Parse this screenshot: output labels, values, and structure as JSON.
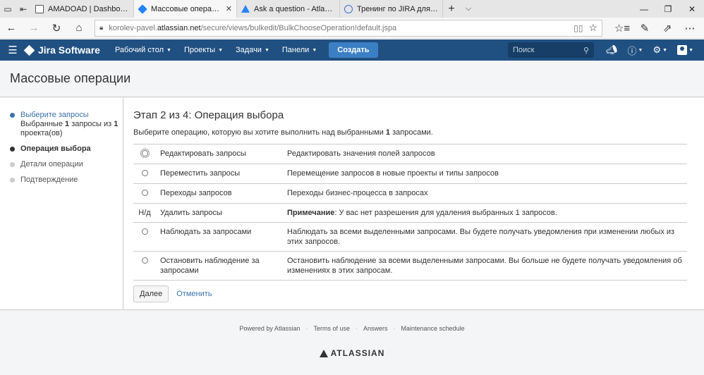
{
  "browser": {
    "tabs": [
      {
        "title": "AMADOAD | Dashboard",
        "icon": "board-icon"
      },
      {
        "title": "Массовые операции -",
        "icon": "jira-icon",
        "active": true
      },
      {
        "title": "Ask a question - Atlassian C",
        "icon": "atlassian-icon"
      },
      {
        "title": "Тренинг по JIRA для разра",
        "icon": "globe-icon"
      }
    ],
    "url_prefix": "korolev-pavel.",
    "url_domain": "atlassian.net",
    "url_path": "/secure/views/bulkedit/BulkChooseOperation!default.jspa"
  },
  "header": {
    "logo_text": "Jira Software",
    "nav": [
      "Рабочий стол",
      "Проекты",
      "Задачи",
      "Панели"
    ],
    "create_label": "Создать",
    "search_placeholder": "Поиск"
  },
  "page_title": "Массовые операции",
  "steps": {
    "s1_link": "Выберите запросы",
    "s1_sub_a": "Выбранные ",
    "s1_sub_b": "1",
    "s1_sub_c": " запросы из ",
    "s1_sub_d": "1",
    "s1_sub_e": " проекта(ов)",
    "s2": "Операция выбора",
    "s3": "Детали операции",
    "s4": "Подтверждение"
  },
  "content": {
    "heading": "Этап 2 из 4: Операция выбора",
    "desc_a": "Выберите операцию, которую вы хотите выполнить над выбранными ",
    "desc_b": "1",
    "desc_c": " запросами.",
    "ops": [
      {
        "name": "Редактировать запросы",
        "desc": "Редактировать значения полей запросов"
      },
      {
        "name": "Переместить запросы",
        "desc": "Перемещение запросов в новые проекты и типы запросов"
      },
      {
        "name": "Переходы запросов",
        "desc": "Переходы бизнес-процесса в запросах"
      },
      {
        "na": "Н/д",
        "name": "Удалить запросы",
        "note_label": "Примечание",
        "note_text": ": У вас нет разрешения для удаления выбранных 1 запросов."
      },
      {
        "name": "Наблюдать за запросами",
        "desc": "Наблюдать за всеми выделенными запросами. Вы будете получать уведомления при изменении любых из этих запросов."
      },
      {
        "name": "Остановить наблюдение за запросами",
        "desc": "Остановить наблюдение за всеми выделенными запросами. Вы больше не будете получать уведомления об изменениях в этих запросам."
      }
    ],
    "next_label": "Далее",
    "cancel_label": "Отменить"
  },
  "footer": {
    "links": [
      "Powered by Atlassian",
      "Terms of use",
      "Answers",
      "Maintenance schedule"
    ],
    "logo_text": "ATLASSIAN"
  }
}
